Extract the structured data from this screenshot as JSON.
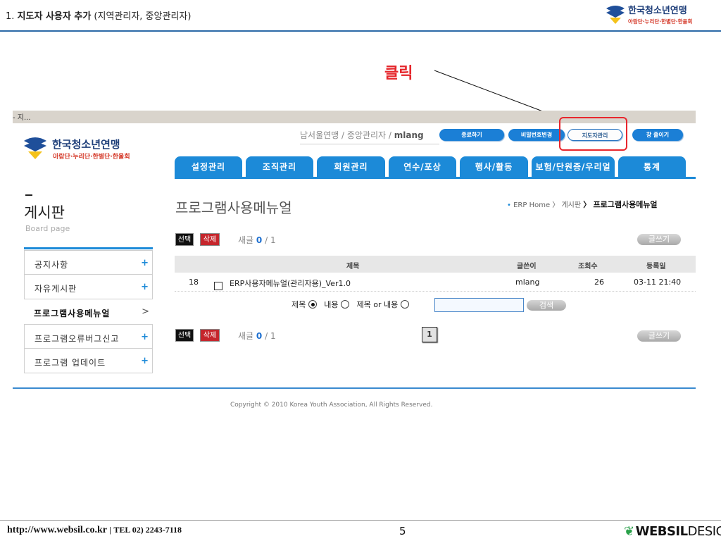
{
  "slide": {
    "title_num": "1.",
    "title_main": "지도자 사용자 추가",
    "title_sub": "(지역관리자, 중앙관리자)",
    "annotation": "클릭"
  },
  "logo": {
    "name": "한국청소년연맹",
    "sub": "아람단·누리단·한별단·한울회"
  },
  "window_bar": {
    "text": "- 지..."
  },
  "header": {
    "user_region": "남서울연맹",
    "sep1": " / ",
    "user_role": "중앙관리자",
    "sep2": " / ",
    "user_id": "mlang",
    "buttons": [
      "종료하기",
      "비밀번호변경",
      "지도자관리",
      "창 줄이기"
    ]
  },
  "nav": {
    "tabs": [
      "설정관리",
      "조직관리",
      "회원관리",
      "연수/포상",
      "행사/활동",
      "보험/단원증/우리얼",
      "통계"
    ]
  },
  "sidebar": {
    "dash": "–",
    "title": "게시판",
    "subtitle": "Board page",
    "items": [
      {
        "label": "공지사항",
        "marker": "+"
      },
      {
        "label": "자유게시판",
        "marker": "+"
      },
      {
        "label": "프로그램사용메뉴얼",
        "marker": ">"
      },
      {
        "label": "프로그램오류버그신고",
        "marker": "+"
      },
      {
        "label": "프로그램 업데이트",
        "marker": "+"
      }
    ]
  },
  "main": {
    "title": "프로그램사용메뉴얼",
    "breadcrumb": {
      "bullet": "•",
      "home": "ERP Home",
      "sep1": "〉",
      "board": "게시판",
      "sep2": "〉",
      "current": "프로그램사용메뉴얼"
    },
    "actions": {
      "select": "선택",
      "delete": "삭제",
      "new_label": "새글",
      "new_count": "0",
      "total_sep": " / ",
      "total": "1",
      "write": "글쓰기"
    },
    "table": {
      "columns": [
        "제목",
        "글쓴이",
        "조회수",
        "등록일"
      ],
      "rows": [
        {
          "no": "18",
          "title": "ERP사용자메뉴얼(관리자용)_Ver1.0",
          "author": "mlang",
          "views": "26",
          "date": "03-11 21:40"
        }
      ]
    },
    "search": {
      "opt_title": "제목",
      "opt_content": "내용",
      "opt_both": "제목 or 내용",
      "selected": "제목",
      "value": "",
      "button": "검색"
    },
    "pagination": {
      "current": "1"
    }
  },
  "footer": {
    "copyright": "Copyright © 2010 Korea Youth Association, All Rights Reserved."
  },
  "slide_footer": {
    "url": "http://www.websil.co.kr",
    "sep": "|",
    "tel": "TEL 02) 2243-7118",
    "page": "5",
    "brand_bold": "WEBSIL",
    "brand_light": "DESIGN"
  },
  "colors": {
    "accent_blue": "#1c8ad8",
    "highlight_red": "#e8262d",
    "delete_red": "#c5262c",
    "brand_green": "#2aa14a"
  }
}
